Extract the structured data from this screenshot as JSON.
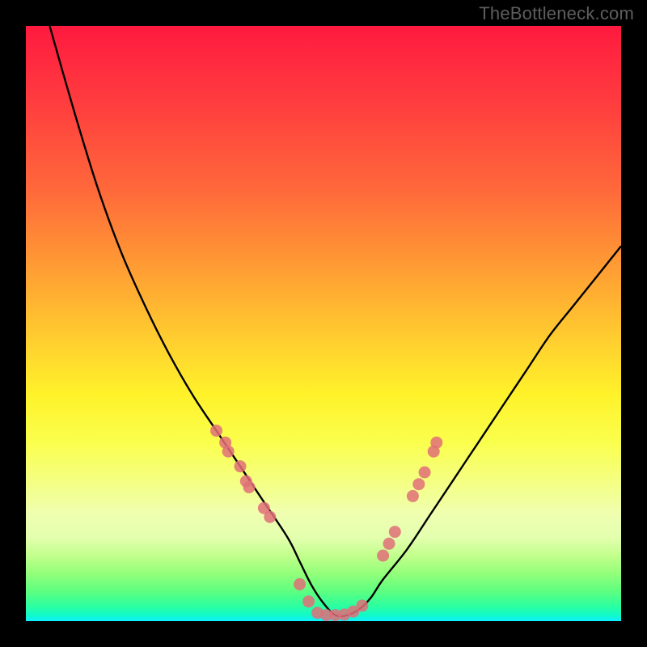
{
  "watermark": "TheBottleneck.com",
  "chart_data": {
    "type": "line",
    "title": "",
    "xlabel": "",
    "ylabel": "",
    "xlim": [
      0,
      100
    ],
    "ylim": [
      0,
      100
    ],
    "grid": false,
    "legend": false,
    "series": [
      {
        "name": "bottleneck-curve",
        "x": [
          4,
          8,
          12,
          16,
          20,
          24,
          28,
          32,
          36,
          40,
          44,
          46,
          48,
          50,
          52,
          54,
          56,
          58,
          60,
          64,
          68,
          72,
          76,
          80,
          84,
          88,
          92,
          96,
          100
        ],
        "y": [
          100,
          86,
          73,
          62,
          53,
          45,
          38,
          32,
          26,
          20,
          14,
          10,
          6,
          3,
          1,
          1,
          2,
          4,
          7,
          12,
          18,
          24,
          30,
          36,
          42,
          48,
          53,
          58,
          63
        ]
      }
    ],
    "annotations": {
      "optimal_zone_y": 1,
      "marker_clusters": [
        {
          "name": "left-slope-markers",
          "points": [
            {
              "x": 32,
              "y": 32
            },
            {
              "x": 33.5,
              "y": 30
            },
            {
              "x": 34,
              "y": 28.5
            },
            {
              "x": 36,
              "y": 26
            },
            {
              "x": 37,
              "y": 23.5
            },
            {
              "x": 37.5,
              "y": 22.5
            },
            {
              "x": 40,
              "y": 19
            },
            {
              "x": 41,
              "y": 17.5
            }
          ]
        },
        {
          "name": "valley-markers",
          "points": [
            {
              "x": 46,
              "y": 6.2
            },
            {
              "x": 47.5,
              "y": 3.3
            },
            {
              "x": 49,
              "y": 1.4
            },
            {
              "x": 50.5,
              "y": 1
            },
            {
              "x": 52,
              "y": 1
            },
            {
              "x": 53.5,
              "y": 1.1
            },
            {
              "x": 55,
              "y": 1.6
            },
            {
              "x": 56.5,
              "y": 2.6
            }
          ]
        },
        {
          "name": "right-slope-markers",
          "points": [
            {
              "x": 60,
              "y": 11
            },
            {
              "x": 61,
              "y": 13
            },
            {
              "x": 62,
              "y": 15
            },
            {
              "x": 65,
              "y": 21
            },
            {
              "x": 66,
              "y": 23
            },
            {
              "x": 67,
              "y": 25
            },
            {
              "x": 68.5,
              "y": 28.5
            },
            {
              "x": 69,
              "y": 30
            }
          ]
        }
      ]
    },
    "colors": {
      "curve": "#000000",
      "markers": "#e06f78",
      "gradient_top": "#ff1a3f",
      "gradient_mid": "#fff22a",
      "gradient_bottom": "#12f9c8"
    }
  }
}
